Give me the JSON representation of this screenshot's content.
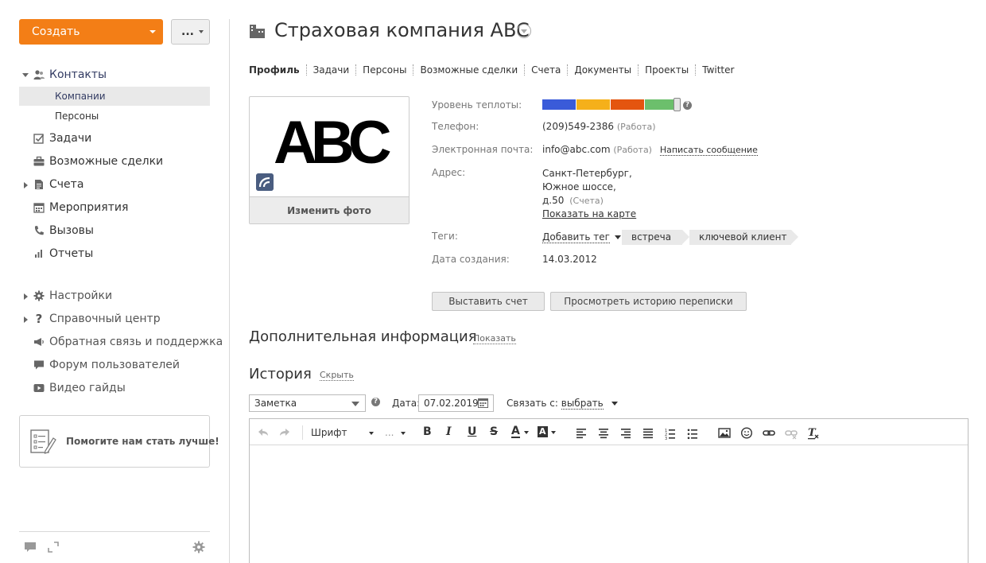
{
  "sidebar": {
    "create_label": "Создать",
    "more_label": "...",
    "nav": {
      "contacts": "Контакты",
      "companies": "Компании",
      "persons": "Персоны",
      "tasks": "Задачи",
      "deals": "Возможные сделки",
      "invoices": "Счета",
      "events": "Мероприятия",
      "calls": "Вызовы",
      "reports": "Отчеты",
      "settings": "Настройки",
      "help_center": "Справочный центр",
      "feedback": "Обратная связь и поддержка",
      "forum": "Форум пользователей",
      "video": "Видео гайды"
    },
    "help_box_text": "Помогите нам стать лучше!"
  },
  "page": {
    "title": "Страховая компания ABC",
    "tabs": [
      "Профиль",
      "Задачи",
      "Персоны",
      "Возможные сделки",
      "Счета",
      "Документы",
      "Проекты",
      "Twitter"
    ]
  },
  "profile": {
    "logo_text": "ABC",
    "change_photo": "Изменить фото",
    "labels": {
      "heat": "Уровень теплоты:",
      "phone": "Телефон:",
      "email": "Электронная почта:",
      "address": "Адрес:",
      "tags": "Теги:",
      "created": "Дата создания:"
    },
    "heat_colors": [
      "#3a5bd9",
      "#f5b01a",
      "#e4550f",
      "#6cbf6c"
    ],
    "phone": "(209)549-2386",
    "phone_type": "(Работа)",
    "email": "info@abc.com",
    "email_type": "(Работа)",
    "write_message": "Написать сообщение",
    "address_line1": "Санкт-Петербург,",
    "address_line2": "Южное шоссе,",
    "address_line3": "д.50",
    "address_type": "(Счета)",
    "show_on_map": "Показать на карте",
    "add_tag": "Добавить тег",
    "tags": [
      "встреча",
      "ключевой клиент"
    ],
    "created_date": "14.03.2012"
  },
  "actions": {
    "invoice": "Выставить счет",
    "history": "Просмотреть историю переписки"
  },
  "additional": {
    "title": "Дополнительная информация",
    "toggle": "Показать"
  },
  "history": {
    "title": "История",
    "toggle": "Скрыть",
    "type_selected": "Заметка",
    "date_label": "Дата:",
    "date_value": "07.02.2019",
    "link_label": "Связать с:",
    "link_value": "выбрать"
  },
  "editor": {
    "font_label": "Шрифт",
    "size_label": "..."
  }
}
